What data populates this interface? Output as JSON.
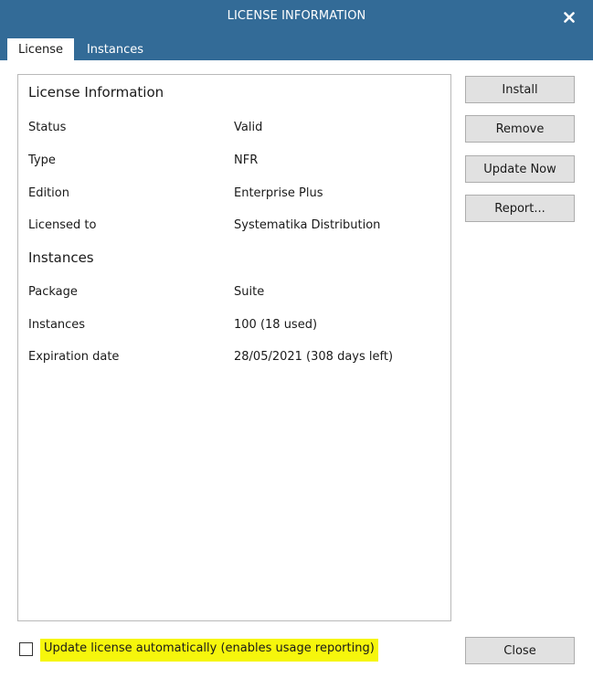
{
  "window": {
    "title": "LICENSE INFORMATION",
    "close_icon": "close-icon"
  },
  "tabs": [
    {
      "label": "License",
      "active": true
    },
    {
      "label": "Instances",
      "active": false
    }
  ],
  "license_info": {
    "heading": "License Information",
    "rows": [
      {
        "label": "Status",
        "value": "Valid"
      },
      {
        "label": "Type",
        "value": "NFR"
      },
      {
        "label": "Edition",
        "value": "Enterprise Plus"
      },
      {
        "label": "Licensed to",
        "value": "Systematika Distribution"
      }
    ]
  },
  "instances_info": {
    "heading": "Instances",
    "rows": [
      {
        "label": "Package",
        "value": "Suite"
      },
      {
        "label": "Instances",
        "value": "100 (18 used)"
      },
      {
        "label": "Expiration date",
        "value": "28/05/2021 (308 days left)"
      }
    ]
  },
  "buttons": {
    "install": "Install",
    "remove": "Remove",
    "update_now": "Update Now",
    "report": "Report...",
    "close": "Close"
  },
  "auto_update": {
    "label": "Update license automatically (enables usage reporting)",
    "checked": false,
    "highlight_color": "#f6f60c"
  },
  "colors": {
    "titlebar": "#336b97",
    "button_face": "#e1e1e1"
  }
}
